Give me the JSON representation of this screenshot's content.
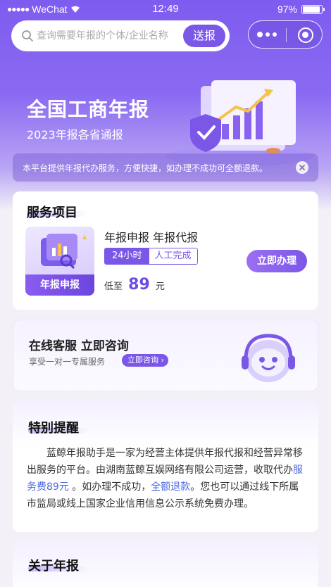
{
  "status_bar": {
    "carrier": "WeChat",
    "time": "12:49",
    "battery": "97%"
  },
  "search": {
    "placeholder": "查询需要年报的个体/企业名称",
    "button_label": "送报"
  },
  "hero": {
    "title": "全国工商年报",
    "subtitle": "2023年报各省通报"
  },
  "notice": {
    "text": "本平台提供年报代办服务，方便快捷，如办理不成功可全额退款。"
  },
  "service": {
    "section_title": "服务项目",
    "thumb_label": "年报申报",
    "name": "年报申报 年报代报",
    "tag_primary": "24小时",
    "tag_secondary": "人工完成",
    "price_prefix": "低至",
    "price_value": "89",
    "price_unit": "元",
    "action_label": "立即办理"
  },
  "customer_service": {
    "title": "在线客服 立即咨询",
    "subtitle": "享受一对一专属服务",
    "button_label": "立即咨询"
  },
  "reminder": {
    "section_title": "特别提醒",
    "text_part1": "蓝鲸年报助手是一家为经营主体提供年报代报和经营异常移出服务的平台。由湖南蓝鲸互娱网络有限公司运营，收取代办",
    "link_fee": "服务费89元",
    "text_part2": " 。如办理不成功，",
    "link_refund": "全额退款",
    "text_part3": "。您也可以通过线下所属市监局或线上国家企业信用信息公示系统免费办理。"
  },
  "about": {
    "section_title": "关于年报"
  },
  "colors": {
    "accent": "#7b57e8",
    "link": "#4b69e0"
  }
}
